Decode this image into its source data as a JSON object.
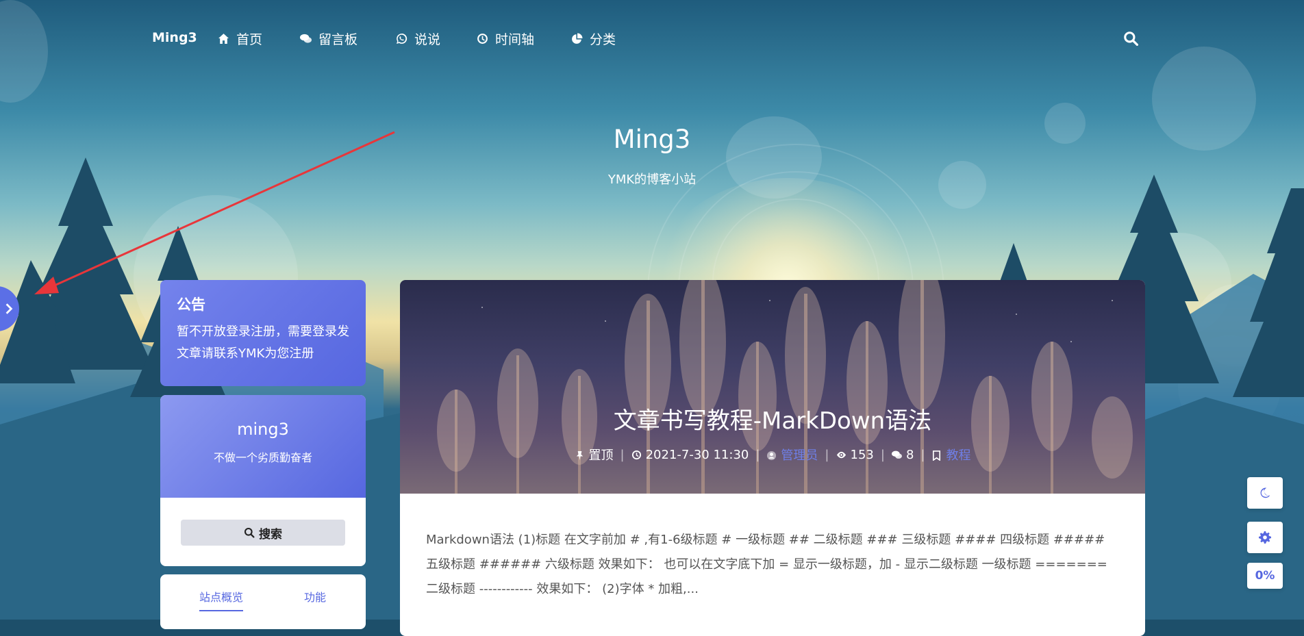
{
  "nav": {
    "brand": "Ming3",
    "items": [
      {
        "label": "首页",
        "icon": "home-icon"
      },
      {
        "label": "留言板",
        "icon": "comments-icon"
      },
      {
        "label": "说说",
        "icon": "whatsapp-icon"
      },
      {
        "label": "时间轴",
        "icon": "clock-icon"
      },
      {
        "label": "分类",
        "icon": "pie-chart-icon"
      }
    ],
    "search_icon": "search-icon"
  },
  "hero": {
    "title": "Ming3",
    "subtitle": "YMK的博客小站"
  },
  "sidebar": {
    "notice": {
      "title": "公告",
      "text": "暂不开放登录注册，需要登录发文章请联系YMK为您注册"
    },
    "profile": {
      "name": "ming3",
      "motto": "不做一个劣质勤奋者",
      "search_label": "搜索"
    },
    "tabs": [
      "站点概览",
      "功能"
    ]
  },
  "post": {
    "title": "文章书写教程-MarkDown语法",
    "meta": {
      "pinned": "置顶",
      "date": "2021-7-30 11:30",
      "author": "管理员",
      "views": "153",
      "comments": "8",
      "category": "教程"
    },
    "excerpt": "Markdown语法 (1)标题 在文字前加 # ,有1-6级标题 # 一级标题 ## 二级标题 ### 三级标题 #### 四级标题 ##### 五级标题 ###### 六级标题 效果如下：  也可以在文字底下加 = 显示一级标题，加 - 显示二级标题 一级标题 ======= 二级标题 ------------ 效果如下：  (2)字体 * 加粗,..."
  },
  "floating": {
    "progress": "0%"
  },
  "colors": {
    "accent": "#5667e0",
    "annotation_arrow": "#e8363a"
  }
}
